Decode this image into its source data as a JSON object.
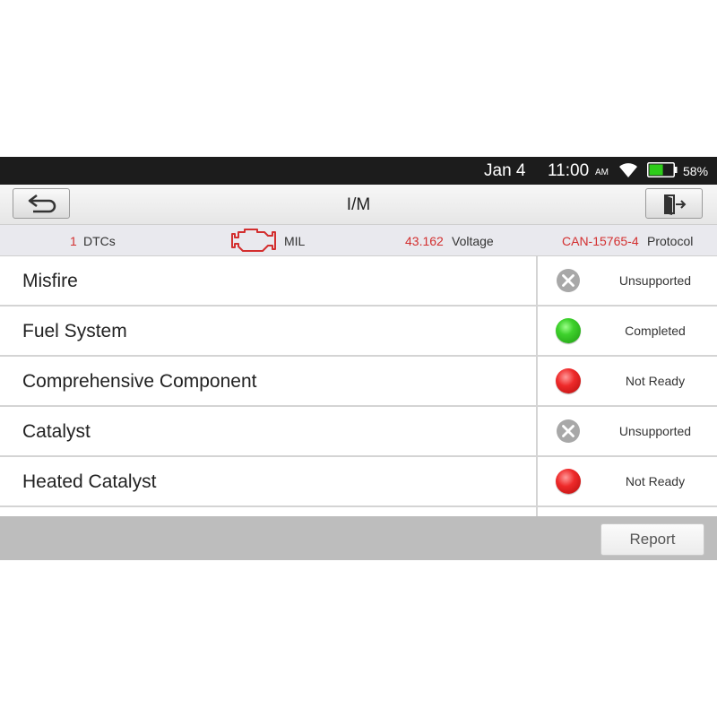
{
  "status_bar": {
    "date": "Jan 4",
    "time": "11:00",
    "ampm": "AM",
    "wifi_icon": "wifi-icon",
    "battery_icon": "battery-icon",
    "battery_percent": "58%",
    "battery_level": 0.58,
    "battery_color": "#2ecc1a"
  },
  "title_bar": {
    "title": "I/M",
    "back_icon": "back-arrow-icon",
    "exit_icon": "exit-door-icon"
  },
  "info_bar": {
    "dtc_count": "1",
    "dtc_label": "DTCs",
    "mil_icon": "check-engine-icon",
    "mil_label": "MIL",
    "voltage_value": "43.162",
    "voltage_label": "Voltage",
    "protocol_value": "CAN-15765-4",
    "protocol_label": "Protocol",
    "accent_color": "#d32f2f"
  },
  "monitors": [
    {
      "name": "Misfire",
      "status": "Unsupported",
      "icon": "unsupported-x-icon"
    },
    {
      "name": "Fuel System",
      "status": "Completed",
      "icon": "green-dot-icon"
    },
    {
      "name": "Comprehensive Component",
      "status": "Not Ready",
      "icon": "red-dot-icon"
    },
    {
      "name": "Catalyst",
      "status": "Unsupported",
      "icon": "unsupported-x-icon"
    },
    {
      "name": "Heated Catalyst",
      "status": "Not Ready",
      "icon": "red-dot-icon"
    }
  ],
  "footer": {
    "report_label": "Report"
  }
}
